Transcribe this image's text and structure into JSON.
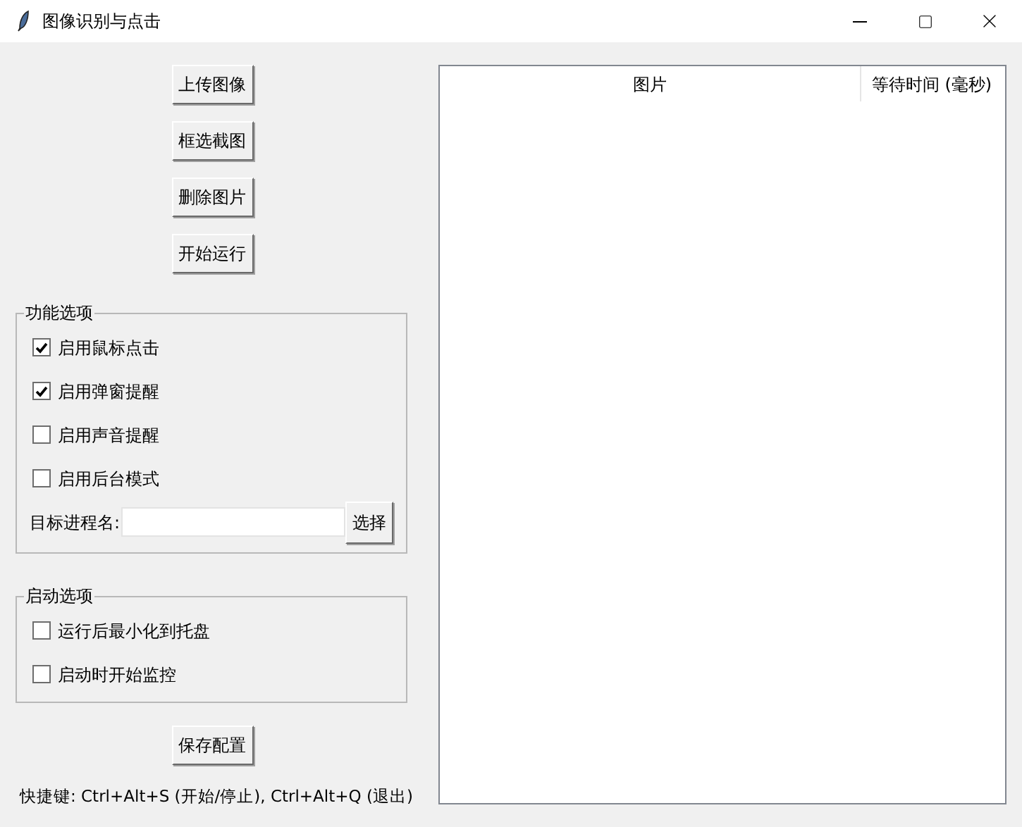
{
  "window": {
    "title": "图像识别与点击"
  },
  "actions": [
    "上传图像",
    "框选截图",
    "删除图片",
    "开始运行"
  ],
  "feature_options": {
    "title": "功能选项",
    "items": [
      {
        "label": "启用鼠标点击",
        "checked": true
      },
      {
        "label": "启用弹窗提醒",
        "checked": true
      },
      {
        "label": "启用声音提醒",
        "checked": false
      },
      {
        "label": "启用后台模式",
        "checked": false
      }
    ],
    "process_field": {
      "label": "目标进程名:",
      "button": "选择"
    }
  },
  "startup_options": {
    "title": "启动选项",
    "items": [
      {
        "label": "运行后最小化到托盘",
        "checked": false
      },
      {
        "label": "启动时开始监控",
        "checked": false
      }
    ]
  },
  "save_button": "保存配置",
  "shortcut_hint": "快捷键: Ctrl+Alt+S (开始/停止), Ctrl+Alt+Q (退出)",
  "table": {
    "columns": [
      "图片",
      "等待时间 (毫秒)"
    ]
  }
}
